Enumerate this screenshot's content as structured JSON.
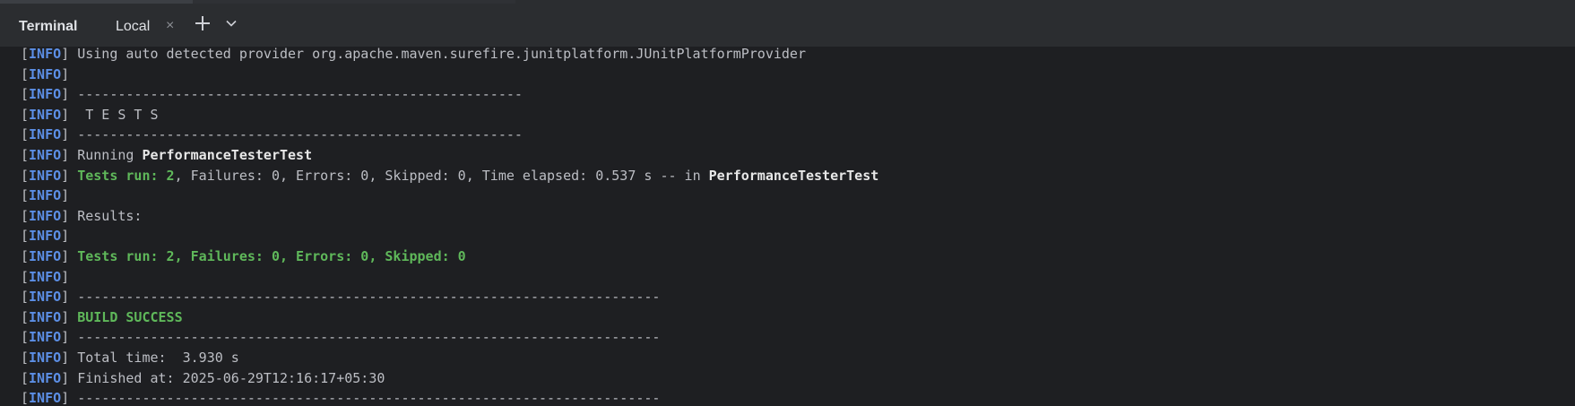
{
  "toolwindow": {
    "title": "Terminal",
    "tab_label": "Local",
    "tab_close": "×",
    "add_tab_icon": "plus-icon",
    "dropdown_icon": "chevron-down-icon"
  },
  "colors": {
    "background": "#1e1f22",
    "toolbar": "#2b2d30",
    "info": "#5c8fe6",
    "success": "#5fb85a",
    "accent": "#3574f0"
  },
  "terminal": {
    "tag": "INFO",
    "lines": [
      {
        "segments": [
          {
            "t": "Using auto detected provider org.apache.maven.surefire.junitplatform.JUnitPlatformProvider",
            "c": ""
          }
        ]
      },
      {
        "segments": []
      },
      {
        "segments": [
          {
            "t": "-------------------------------------------------------",
            "c": ""
          }
        ]
      },
      {
        "segments": [
          {
            "t": " T E S T S",
            "c": ""
          }
        ]
      },
      {
        "segments": [
          {
            "t": "-------------------------------------------------------",
            "c": ""
          }
        ]
      },
      {
        "segments": [
          {
            "t": "Running ",
            "c": ""
          },
          {
            "t": "PerformanceTesterTest",
            "c": "white"
          }
        ]
      },
      {
        "segments": [
          {
            "t": "Tests run: 2",
            "c": "greenb"
          },
          {
            "t": ", Failures: 0, Errors: 0, Skipped: 0, Time elapsed: 0.537 s -- in ",
            "c": ""
          },
          {
            "t": "PerformanceTesterTest",
            "c": "white"
          }
        ]
      },
      {
        "segments": []
      },
      {
        "segments": [
          {
            "t": "Results:",
            "c": ""
          }
        ]
      },
      {
        "segments": []
      },
      {
        "segments": [
          {
            "t": "Tests run: 2, Failures: 0, Errors: 0, Skipped: 0",
            "c": "greenb"
          }
        ]
      },
      {
        "segments": []
      },
      {
        "segments": [
          {
            "t": "------------------------------------------------------------------------",
            "c": ""
          }
        ]
      },
      {
        "segments": [
          {
            "t": "BUILD SUCCESS",
            "c": "greenb"
          }
        ]
      },
      {
        "segments": [
          {
            "t": "------------------------------------------------------------------------",
            "c": ""
          }
        ]
      },
      {
        "segments": [
          {
            "t": "Total time:  3.930 s",
            "c": ""
          }
        ]
      },
      {
        "segments": [
          {
            "t": "Finished at: 2025-06-29T12:16:17+05:30",
            "c": ""
          }
        ]
      },
      {
        "segments": [
          {
            "t": "------------------------------------------------------------------------",
            "c": ""
          }
        ]
      }
    ]
  }
}
